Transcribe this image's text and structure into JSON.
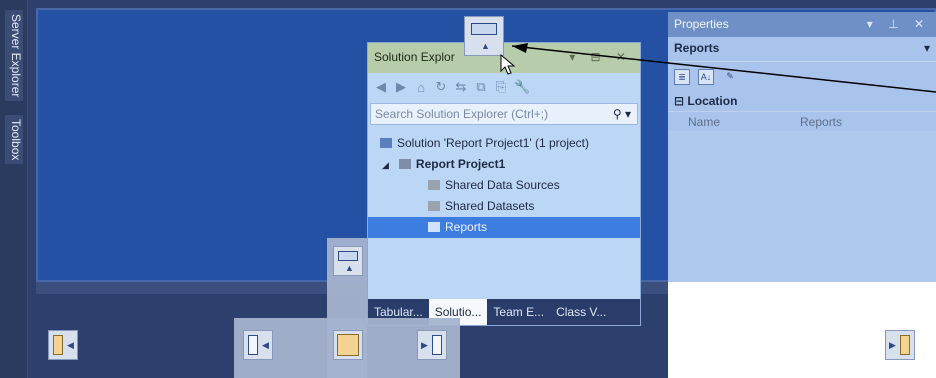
{
  "side_tabs": [
    "Server Explorer",
    "Toolbox"
  ],
  "properties": {
    "title": "Properties",
    "title_controls": "▾ ⊥ ✕",
    "object": "Reports",
    "object_dropdown": "▾",
    "section": "Location",
    "section_toggle": "⊟",
    "rows": [
      {
        "key": "Name",
        "value": "Reports"
      }
    ],
    "toolbar_icons": [
      "categorized-icon",
      "alphabetical-icon",
      "wrench-icon"
    ]
  },
  "solution_explorer": {
    "title": "Solution Explor",
    "title_controls": "▾ ⊟ ✕",
    "search_placeholder": "Search Solution Explorer (Ctrl+;)",
    "search_icon": "⚲ ▾",
    "toolbar_glyphs": [
      "◀",
      "▶",
      "⌂",
      "↻",
      "⇆",
      "⧉",
      "⎘",
      "🔧"
    ],
    "tree": [
      {
        "label": "Solution 'Report Project1' (1 project)",
        "icon": "solution-icon",
        "indent": 0
      },
      {
        "label": "Report Project1",
        "icon": "report-project-icon",
        "indent": 1,
        "bold": true,
        "expander": "◢"
      },
      {
        "label": "Shared Data Sources",
        "icon": "folder-icon",
        "indent": 2
      },
      {
        "label": "Shared Datasets",
        "icon": "folder-icon",
        "indent": 2
      },
      {
        "label": "Reports",
        "icon": "folder-icon",
        "indent": 2,
        "selected": true
      }
    ],
    "tabs": [
      "Tabular...",
      "Solutio...",
      "Team E...",
      "Class V..."
    ],
    "active_tab": 1
  },
  "colors": {
    "accent": "#3e7de0",
    "dock_preview": "#2552a8",
    "background": "#2d3f6c"
  }
}
